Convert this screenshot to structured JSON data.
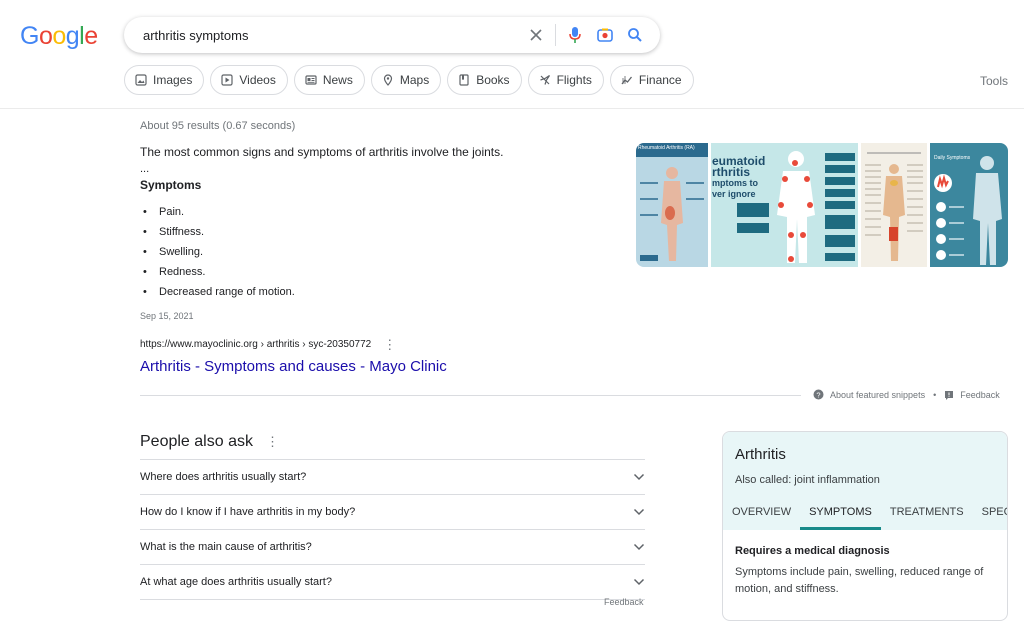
{
  "logo": {
    "letters": [
      "G",
      "o",
      "o",
      "g",
      "l",
      "e"
    ],
    "colors": [
      "#4285f4",
      "#ea4335",
      "#fbbc05",
      "#4285f4",
      "#34a853",
      "#ea4335"
    ]
  },
  "search": {
    "value": "arthritis symptoms"
  },
  "chips": [
    {
      "label": "Images",
      "icon": "image-icon"
    },
    {
      "label": "Videos",
      "icon": "video-icon"
    },
    {
      "label": "News",
      "icon": "news-icon"
    },
    {
      "label": "Maps",
      "icon": "map-pin-icon"
    },
    {
      "label": "Books",
      "icon": "book-icon"
    },
    {
      "label": "Flights",
      "icon": "plane-icon"
    },
    {
      "label": "Finance",
      "icon": "finance-icon"
    }
  ],
  "tools_label": "Tools",
  "stats": "About 95 results (0.67 seconds)",
  "snippet": {
    "text": "The most common signs and symptoms of arthritis involve the joints.",
    "ellipsis": "...",
    "heading": "Symptoms",
    "items": [
      "Pain.",
      "Stiffness.",
      "Swelling.",
      "Redness.",
      "Decreased range of motion."
    ],
    "date": "Sep 15, 2021",
    "cite": "https://www.mayoclinic.org › arthritis › syc-20350772",
    "title": "Arthritis - Symptoms and causes - Mayo Clinic",
    "about_label": "About featured snippets",
    "feedback_label": "Feedback",
    "image_texts": {
      "img1_title": "Rheumatoid Arthritis (RA)",
      "img2_lines": [
        "eumatoid",
        "rthritis",
        "mptoms to",
        "ver ignore"
      ],
      "img4_title": "Daily Symptoms"
    }
  },
  "paa": {
    "title": "People also ask",
    "questions": [
      "Where does arthritis usually start?",
      "How do I know if I have arthritis in my body?",
      "What is the main cause of arthritis?",
      "At what age does arthritis usually start?"
    ],
    "feedback_label": "Feedback"
  },
  "kp": {
    "title": "Arthritis",
    "subtitle": "Also called: joint inflammation",
    "tabs": [
      "OVERVIEW",
      "SYMPTOMS",
      "TREATMENTS",
      "SPEC"
    ],
    "active_tab": "SYMPTOMS",
    "body_title": "Requires a medical diagnosis",
    "body_text": "Symptoms include pain, swelling, reduced range of motion, and stiffness."
  }
}
